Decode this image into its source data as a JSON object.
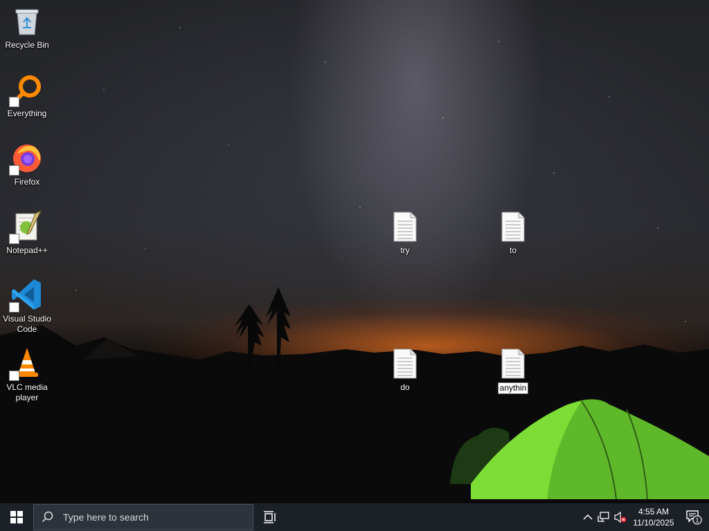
{
  "desktop": {
    "icons": [
      {
        "label": "Recycle Bin",
        "icon": "recycle-bin-icon"
      },
      {
        "label": "Everything",
        "icon": "everything-search-icon"
      },
      {
        "label": "Firefox",
        "icon": "firefox-icon"
      },
      {
        "label": "Notepad++",
        "icon": "notepad-plus-plus-icon"
      },
      {
        "label": "Visual Studio Code",
        "icon": "vscode-icon"
      },
      {
        "label": "VLC media player",
        "icon": "vlc-icon"
      }
    ],
    "files": [
      {
        "label": "try",
        "icon": "text-file-icon"
      },
      {
        "label": "to",
        "icon": "text-file-icon"
      },
      {
        "label": "do",
        "icon": "text-file-icon"
      },
      {
        "label": "anythin",
        "icon": "text-file-icon",
        "selected": true
      }
    ]
  },
  "taskbar": {
    "search_placeholder": "Type here to search",
    "clock": {
      "time": "4:55 AM",
      "date": "11/10/2025"
    },
    "notification_count": "1"
  },
  "colors": {
    "taskbar_bg": "#1c2128",
    "search_bg": "#2d333b",
    "start_icon": "#ffffff"
  }
}
